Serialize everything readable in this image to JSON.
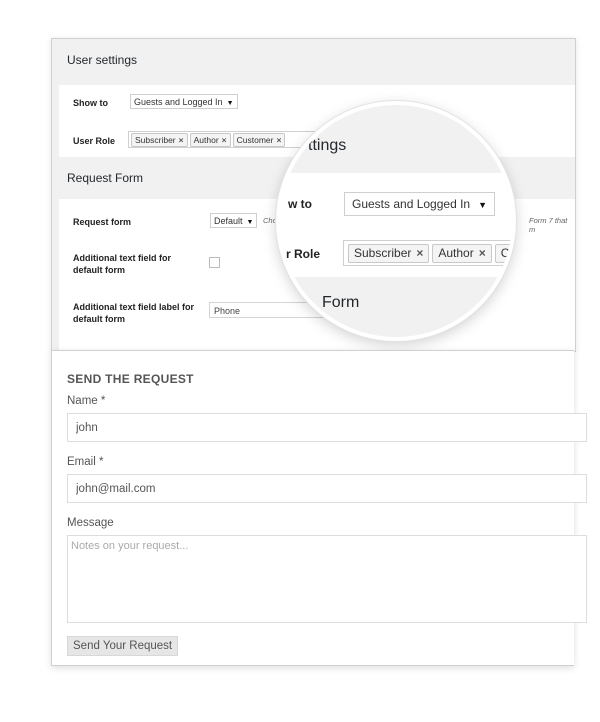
{
  "user_settings": {
    "title": "User settings",
    "show_to_label": "Show to",
    "show_to_value": "Guests and Logged In",
    "user_role_label": "User Role",
    "roles": [
      "Subscriber",
      "Author",
      "Customer"
    ]
  },
  "request_form_settings": {
    "title": "Request Form",
    "request_form_label": "Request form",
    "request_form_value": "Default",
    "request_form_hint": "Choose",
    "request_form_hint_right": "Form 7 that m",
    "additional_field_label": "Additional text field for default form",
    "additional_field_checked": false,
    "additional_label_label": "Additional text field label for default form",
    "additional_label_value": "Phone"
  },
  "magnifier": {
    "title_fragment": "ttings",
    "show_to_fragment": "w to",
    "show_to_value": "Guests and Logged In",
    "user_role_fragment": "r Role",
    "roles": [
      "Subscriber",
      "Author",
      "Cus"
    ],
    "form_fragment": "Form"
  },
  "form": {
    "title": "SEND THE REQUEST",
    "name_label": "Name *",
    "name_value": "john",
    "email_label": "Email *",
    "email_value": "john@mail.com",
    "message_label": "Message",
    "message_placeholder": "Notes on your request...",
    "submit_label": "Send Your Request"
  },
  "icons": {
    "remove": "×",
    "caret": "▼"
  },
  "colors": {
    "panel_bg": "#f1f1f1",
    "box_bg": "#ffffff",
    "button_bg": "#e6e6e6"
  }
}
